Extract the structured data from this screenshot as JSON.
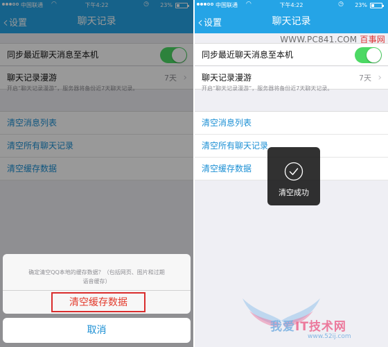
{
  "status_bar": {
    "carrier": "中国联通",
    "time": "下午4:22",
    "battery": "23%"
  },
  "nav": {
    "back_label": "设置",
    "title": "聊天记录"
  },
  "settings": {
    "sync_label": "同步最近聊天消息至本机",
    "sync_enabled": true,
    "roam_label": "聊天记录漫游",
    "roam_value": "7天",
    "hint": "开启“聊天记录漫游”，服务器将备份近7天聊天记录。"
  },
  "actions": [
    "清空消息列表",
    "清空所有聊天记录",
    "清空缓存数据"
  ],
  "action_sheet": {
    "message_line1": "确定清空QQ本地的缓存数据？（包括网页、图片和过期",
    "message_line2": "语音缓存）",
    "confirm_label": "清空缓存数据",
    "cancel_label": "取消"
  },
  "toast": {
    "text": "清空成功"
  },
  "watermarks": {
    "top_site": "WWW.PC841.COM",
    "top_brand": "百事网",
    "bottom_name_a": "我爱",
    "bottom_name_b": "IT技术网",
    "bottom_url": "www.52ij.com"
  },
  "colors": {
    "accent": "#25a4e6",
    "link": "#1b8fd4",
    "toggle_on": "#4cd964",
    "danger": "#e33a2b"
  }
}
